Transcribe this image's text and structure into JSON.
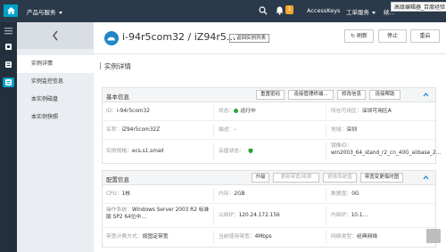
{
  "topbar": {
    "product_menu": "产品与服务",
    "badge_count": "1",
    "accesskeys": "AccessKeys",
    "order_menu": "工单服务",
    "user_partial": "续…",
    "overlay_label": "高级编辑器_百度经验"
  },
  "sidebar": {
    "items": [
      {
        "label": "实例详情"
      },
      {
        "label": "实例监控信息"
      },
      {
        "label": "本实例磁盘"
      },
      {
        "label": "本实例快照"
      }
    ]
  },
  "header": {
    "title": "i-94r5com32 / iZ94r5...",
    "back_link": "返回实例列表",
    "refresh": "刷新",
    "stop": "停止",
    "restart": "重启"
  },
  "section_title": "实例详情",
  "basic": {
    "title": "基本信息",
    "buttons": [
      "重置密码",
      "连接管理终端...",
      "修改信息",
      "连接帮助"
    ],
    "rows": [
      [
        {
          "label": "ID：",
          "value": "i-94r5com32"
        },
        {
          "label": "状态：",
          "value": "运行中"
        },
        {
          "label": "所在可用区：",
          "value": "深圳可用区A"
        }
      ],
      [
        {
          "label": "名称：",
          "value": "iZ94r5com32Z"
        },
        {
          "label": "描述：",
          "value": "-"
        },
        {
          "label": "地域：",
          "value": "深圳"
        }
      ],
      [
        {
          "label": "实例规格：",
          "value": "ecs.s1.small"
        },
        {
          "label": "云盾状态：",
          "value": ""
        },
        {
          "label": "镜像ID：",
          "value": "win2003_64_stand_r2_cn_40G_alibase_2..."
        }
      ]
    ]
  },
  "config": {
    "title": "配置信息",
    "buttons": [
      "升级",
      "更新带宽/续费",
      "更换系统盘",
      "带宽变更临时图"
    ],
    "rows": [
      [
        {
          "label": "CPU：",
          "value": "1核"
        },
        {
          "label": "内存：",
          "value": "2GB"
        },
        {
          "label": "数据盘：",
          "value": "0G"
        }
      ],
      [
        {
          "label": "操作系统：",
          "value": "Windows Server 2003 R2 标准版 SP2 64位中..."
        },
        {
          "label": "公网IP：",
          "value": "120.24.172.156"
        },
        {
          "label": "内网IP：",
          "value": "10.1…"
        }
      ],
      [
        {
          "label": "带宽计费方式：",
          "value": "按固定带宽"
        },
        {
          "label": "当前使用带宽：",
          "value": "4Mbps"
        },
        {
          "label": "网络类型：",
          "value": "经典网络"
        }
      ]
    ]
  },
  "colors": {
    "topbar": "#2b3a4a",
    "accent": "#00a2ca",
    "running": "#2aa33a"
  }
}
